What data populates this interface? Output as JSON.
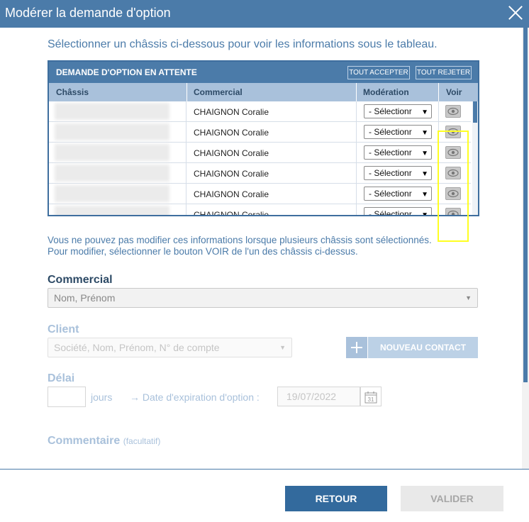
{
  "dialog": {
    "title": "Modérer la demande d'option"
  },
  "intro": "Sélectionner un châssis ci-dessous pour voir les informations sous le tableau.",
  "table": {
    "title": "DEMANDE D'OPTION EN ATTENTE",
    "accept_all": "TOUT ACCEPTER",
    "reject_all": "TOUT REJETER",
    "columns": [
      "Châssis",
      "Commercial",
      "Modération",
      "Voir"
    ],
    "rows": [
      {
        "chassis": "",
        "commercial": "CHAIGNON Coralie",
        "moderation": "- Sélectionr"
      },
      {
        "chassis": "",
        "commercial": "CHAIGNON Coralie",
        "moderation": "- Sélectionr"
      },
      {
        "chassis": "",
        "commercial": "CHAIGNON Coralie",
        "moderation": "- Sélectionr"
      },
      {
        "chassis": "",
        "commercial": "CHAIGNON Coralie",
        "moderation": "- Sélectionr"
      },
      {
        "chassis": "",
        "commercial": "CHAIGNON Coralie",
        "moderation": "- Sélectionr"
      },
      {
        "chassis": "",
        "commercial": "CHAIGNON Coralie",
        "moderation": "- Sélectionr"
      }
    ]
  },
  "note": {
    "line1": "Vous ne pouvez pas modifier ces informations lorsque plusieurs châssis sont sélectionnés.",
    "line2": "Pour modifier, sélectionner le bouton VOIR de l'un des châssis ci-dessus."
  },
  "commercial": {
    "label": "Commercial",
    "placeholder": "Nom, Prénom"
  },
  "client": {
    "label": "Client",
    "placeholder": "Société, Nom, Prénom, N° de compte",
    "new_contact": "NOUVEAU CONTACT"
  },
  "delai": {
    "label": "Délai",
    "unit": "jours",
    "expiration_label": "→ Date d'expiration d'option :",
    "expiration_date": "19/07/2022",
    "calendar_day": "31"
  },
  "commentaire": {
    "label": "Commentaire",
    "sub": "(facultatif)"
  },
  "footer": {
    "back": "RETOUR",
    "validate": "VALIDER"
  },
  "colors": {
    "primary": "#4b7ba9",
    "dark_blue": "#336a9d",
    "light_blue": "#a9c1db",
    "highlight": "#ffff22"
  }
}
